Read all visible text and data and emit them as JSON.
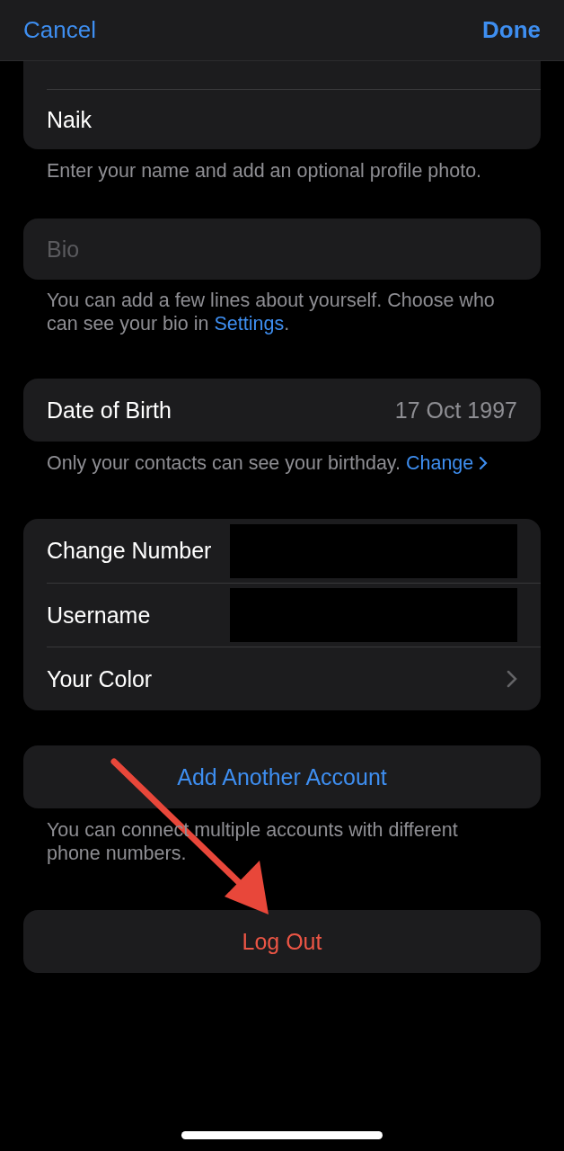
{
  "nav": {
    "cancel": "Cancel",
    "done": "Done"
  },
  "name_section": {
    "rows": [
      "Naik"
    ],
    "caption": "Enter your name and add an optional profile photo."
  },
  "bio": {
    "placeholder": "Bio",
    "caption": "You can add a few lines about yourself. Choose who can see your bio in",
    "caption_link": "Settings",
    "caption_end": "."
  },
  "birthday": {
    "label": "Date of Birth",
    "value": "17 Oct 1997",
    "caption": "Only your contacts can see your birthday.",
    "caption_link": "Change"
  },
  "account_rows": [
    {
      "label": "Change Number",
      "kind": "redacted"
    },
    {
      "label": "Username",
      "kind": "redacted"
    },
    {
      "label": "Your Color",
      "kind": "chevron"
    }
  ],
  "add_account": {
    "label": "Add Another Account",
    "caption": "You can connect multiple accounts with different phone numbers."
  },
  "log_out": {
    "label": "Log Out"
  }
}
